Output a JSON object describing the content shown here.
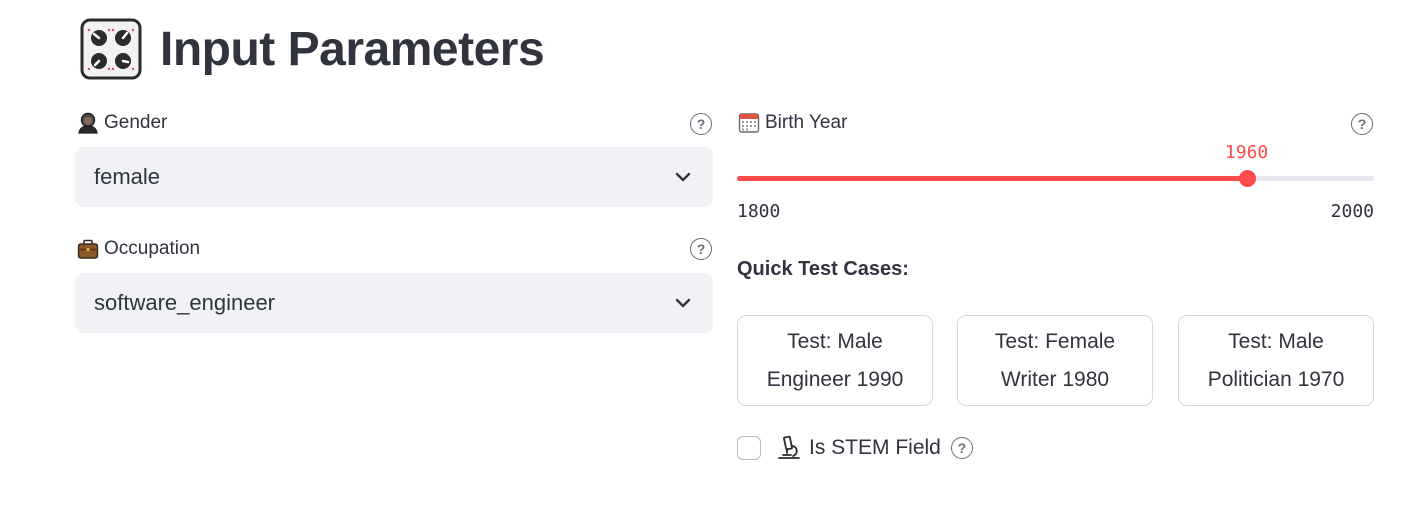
{
  "header": {
    "title": "Input Parameters",
    "icon": "control-knobs-icon"
  },
  "gender": {
    "label": "Gender",
    "icon": "person-icon",
    "value": "female",
    "help_icon": "question-circle-icon"
  },
  "occupation": {
    "label": "Occupation",
    "icon": "briefcase-icon",
    "value": "software_engineer",
    "help_icon": "question-circle-icon"
  },
  "birth_year": {
    "label": "Birth Year",
    "icon": "calendar-icon",
    "min": "1800",
    "max": "2000",
    "value": "1960",
    "help_icon": "question-circle-icon"
  },
  "quick_tests": {
    "heading": "Quick Test Cases:",
    "buttons": [
      {
        "label": "Test: Male Engineer 1990"
      },
      {
        "label": "Test: Female Writer 1980"
      },
      {
        "label": "Test: Male Politician 1970"
      }
    ]
  },
  "stem": {
    "label": "Is STEM Field",
    "icon": "microscope-icon",
    "checked": false
  },
  "colors": {
    "accent": "#ff4b4b",
    "select_bg": "#f0f2f6",
    "text": "#31333f"
  }
}
